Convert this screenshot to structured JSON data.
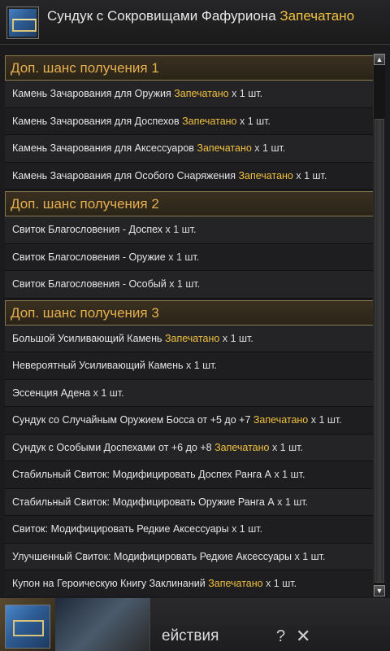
{
  "header": {
    "title": "Сундук с Сокровищами Фафуриона",
    "status": "Запечатано"
  },
  "sections": [
    {
      "title": "Доп. шанс получения 1",
      "items": [
        {
          "name": "Камень Зачарования для Оружия",
          "tag": "Запечатано",
          "qty": "x 1 шт."
        },
        {
          "name": "Камень Зачарования для Доспехов",
          "tag": "Запечатано",
          "qty": "x 1 шт."
        },
        {
          "name": "Камень Зачарования для Аксессуаров",
          "tag": "Запечатано",
          "qty": "x 1 шт."
        },
        {
          "name": "Камень Зачарования для Особого Снаряжения",
          "tag": "Запечатано",
          "qty": "x 1 шт."
        }
      ]
    },
    {
      "title": "Доп. шанс получения 2",
      "items": [
        {
          "name": "Свиток Благословения - Доспех",
          "tag": "",
          "qty": "x 1 шт."
        },
        {
          "name": "Свиток Благословения - Оружие",
          "tag": "",
          "qty": "x 1 шт."
        },
        {
          "name": "Свиток Благословения - Особый",
          "tag": "",
          "qty": "x 1 шт."
        }
      ]
    },
    {
      "title": "Доп. шанс получения 3",
      "items": [
        {
          "name": "Большой Усиливающий Камень",
          "tag": "Запечатано",
          "qty": "x 1 шт."
        },
        {
          "name": "Невероятный Усиливающий Камень",
          "tag": "",
          "qty": "x 1 шт."
        },
        {
          "name": "Эссенция Адена",
          "tag": "",
          "qty": "x 1 шт."
        },
        {
          "name": "Сундук со Случайным Оружием Босса от +5 до +7",
          "tag": "Запечатано",
          "qty": "x 1 шт."
        },
        {
          "name": "Сундук с Особыми Доспехами от +6 до +8",
          "tag": "Запечатано",
          "qty": "x 1 шт."
        },
        {
          "name": "Стабильный Свиток: Модифицировать Доспех Ранга А",
          "tag": "",
          "qty": "x 1 шт."
        },
        {
          "name": "Стабильный Свиток: Модифицировать Оружие Ранга А",
          "tag": "",
          "qty": "x 1 шт."
        },
        {
          "name": "Свиток: Модифицировать Редкие Аксессуары",
          "tag": "",
          "qty": "x 1 шт."
        },
        {
          "name": "Улучшенный Свиток: Модифицировать Редкие Аксессуары",
          "tag": "",
          "qty": "x 1 шт."
        },
        {
          "name": "Купон на Героическую Книгу Заклинаний",
          "tag": "Запечатано",
          "qty": "x 1 шт."
        }
      ]
    }
  ],
  "bottom": {
    "action_label": "ействия",
    "help_symbol": "?",
    "close_symbol": "✕"
  },
  "icons": {
    "chest": "treasure-chest-icon",
    "scroll_up": "arrow-up-icon",
    "scroll_down": "arrow-down-icon"
  },
  "colors": {
    "gold": "#f0c040",
    "section_text": "#e6b050",
    "section_border": "#8a7a52"
  }
}
